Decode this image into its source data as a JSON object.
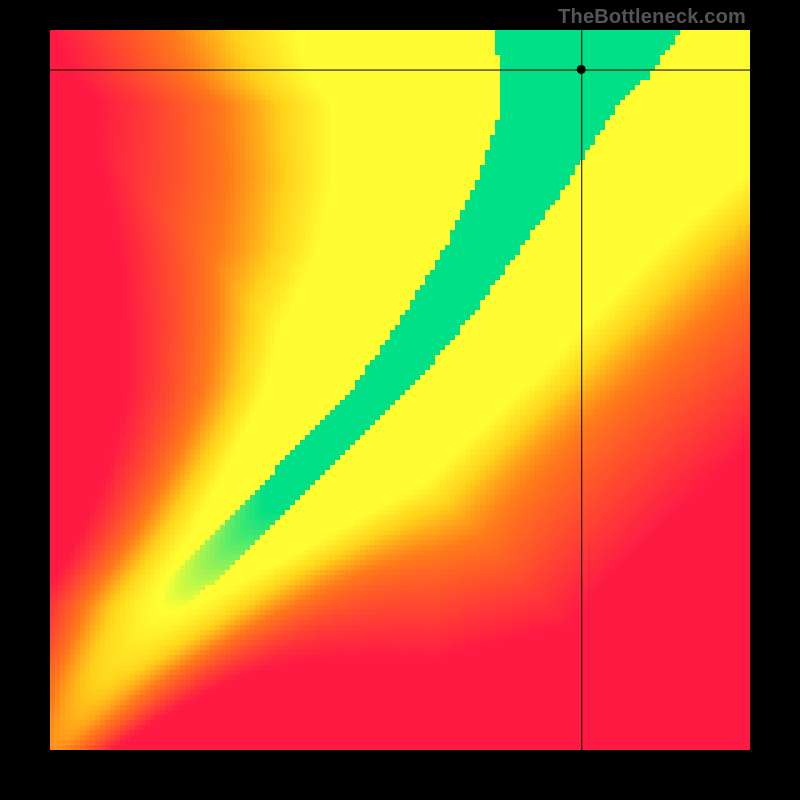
{
  "watermark": "TheBottleneck.com",
  "chart_data": {
    "type": "heatmap",
    "title": "",
    "xlabel": "",
    "ylabel": "",
    "xlim": [
      0,
      1
    ],
    "ylim": [
      0,
      1
    ],
    "colorscale": [
      {
        "value": 0.0,
        "color": "#ff1a44"
      },
      {
        "value": 0.35,
        "color": "#ff7a1a"
      },
      {
        "value": 0.55,
        "color": "#ffd21a"
      },
      {
        "value": 0.75,
        "color": "#ffff33"
      },
      {
        "value": 1.0,
        "color": "#00e086"
      }
    ],
    "ridge": {
      "description": "approximate x-position of the green ridge as a function of y (0=bottom,1=top)",
      "points": [
        {
          "y": 0.0,
          "x": 0.0,
          "width": 0.015
        },
        {
          "y": 0.1,
          "x": 0.07,
          "width": 0.022
        },
        {
          "y": 0.2,
          "x": 0.16,
          "width": 0.028
        },
        {
          "y": 0.3,
          "x": 0.27,
          "width": 0.03
        },
        {
          "y": 0.4,
          "x": 0.37,
          "width": 0.032
        },
        {
          "y": 0.5,
          "x": 0.47,
          "width": 0.035
        },
        {
          "y": 0.6,
          "x": 0.55,
          "width": 0.04
        },
        {
          "y": 0.7,
          "x": 0.62,
          "width": 0.045
        },
        {
          "y": 0.8,
          "x": 0.68,
          "width": 0.055
        },
        {
          "y": 0.9,
          "x": 0.73,
          "width": 0.07
        },
        {
          "y": 0.94,
          "x": 0.75,
          "width": 0.09
        },
        {
          "y": 1.0,
          "x": 0.77,
          "width": 0.11
        }
      ]
    },
    "crosshair": {
      "x": 0.76,
      "y": 0.945
    },
    "grid_resolution": 140
  }
}
